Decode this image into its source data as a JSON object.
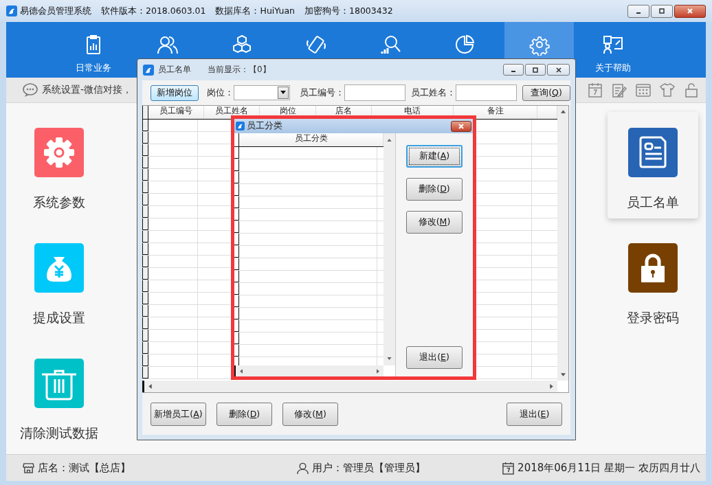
{
  "window": {
    "title": "易德会员管理系统",
    "info": [
      "软件版本：2018.0603.01",
      "数据库名：HuiYuan",
      "加密狗号：18003432"
    ]
  },
  "nav": [
    {
      "label": "日常业务",
      "selected": false
    },
    {
      "selected": false
    },
    {
      "selected": false
    },
    {
      "selected": false
    },
    {
      "selected": false
    },
    {
      "selected": false
    },
    {
      "selected": true
    },
    {
      "label": "关于帮助",
      "selected": false
    }
  ],
  "breadcrumb": "系统设置-微信对接，",
  "tile_columns": [
    [
      {
        "label": "系统参数",
        "color": "#fb6069",
        "selected": false
      },
      {
        "label": "提成设置",
        "color": "#00c8f8",
        "selected": false
      },
      {
        "label": "清除测试数据",
        "color": "#00c0c8",
        "selected": false
      }
    ],
    [
      {
        "label": "员工名单",
        "color": "#2764b4",
        "selected": true
      },
      {
        "label": "登录密码",
        "color": "#774002",
        "selected": false
      }
    ]
  ],
  "status_bar": {
    "store": "店名：测试【总店】",
    "user": "用户：管理员【管理员】",
    "date": "2018年06月11日 星期一 农历四月廿八"
  },
  "employee_dialog": {
    "title": "员工名单",
    "display": "当前显示：【0】",
    "add_position_button": "新增岗位",
    "fields": [
      {
        "kind": "select",
        "label": "岗位："
      },
      {
        "kind": "text",
        "label": "员工编号："
      },
      {
        "kind": "text",
        "label": "员工姓名："
      }
    ],
    "query_button": "查询(Q)",
    "columns": [
      "员工编号",
      "员工姓名",
      "岗位",
      "店名",
      "电话",
      "备注"
    ],
    "buttons": [
      "新增员工(A)",
      "删除(D)",
      "修改(M)",
      "退出(E)"
    ]
  },
  "category_dialog": {
    "title": "员工分类",
    "column": "员工分类",
    "buttons": [
      {
        "label": "新建(A)",
        "focused": true
      },
      {
        "label": "删除(D)",
        "focused": false
      },
      {
        "label": "修改(M)",
        "focused": false
      },
      {
        "label": "退出(E)",
        "focused": false
      }
    ]
  }
}
